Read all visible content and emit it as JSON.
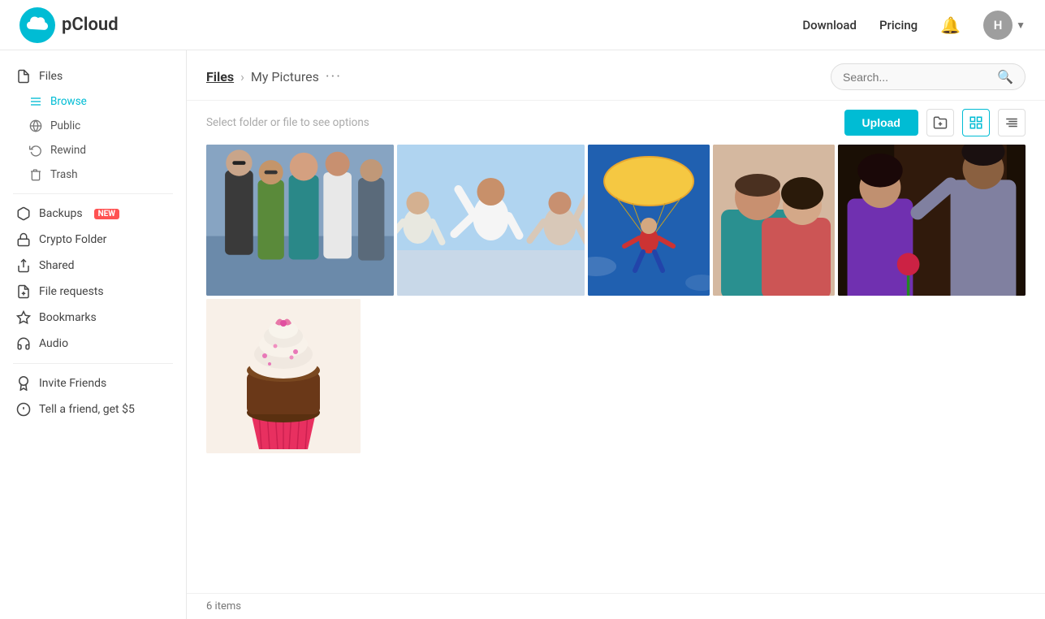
{
  "header": {
    "logo_text": "pCloud",
    "nav": {
      "download": "Download",
      "pricing": "Pricing"
    },
    "user_initial": "H"
  },
  "sidebar": {
    "files_label": "Files",
    "browse_label": "Browse",
    "public_label": "Public",
    "rewind_label": "Rewind",
    "trash_label": "Trash",
    "backups_label": "Backups",
    "backups_badge": "NEW",
    "crypto_folder_label": "Crypto Folder",
    "shared_label": "Shared",
    "file_requests_label": "File requests",
    "bookmarks_label": "Bookmarks",
    "audio_label": "Audio",
    "invite_friends_label": "Invite Friends",
    "tell_friend_label": "Tell a friend, get $5"
  },
  "toolbar": {
    "breadcrumb_root": "Files",
    "breadcrumb_current": "My Pictures",
    "breadcrumb_more": "···"
  },
  "search": {
    "placeholder": "Search..."
  },
  "actions": {
    "hint": "Select folder or file to see options",
    "upload_label": "Upload"
  },
  "photos": {
    "row1": [
      {
        "id": "photo1",
        "color": "#6b7a8d",
        "label": "Group of friends"
      },
      {
        "id": "photo2",
        "color": "#87a7c0",
        "label": "Celebration"
      },
      {
        "id": "photo3",
        "color": "#5b8fbd",
        "label": "Skydiving"
      },
      {
        "id": "photo4",
        "color": "#c9a98e",
        "label": "Couple"
      },
      {
        "id": "photo5",
        "color": "#4a3728",
        "label": "Couple at bar"
      }
    ],
    "row2": [
      {
        "id": "photo6",
        "color": "#e8b4a0",
        "label": "Cupcake"
      }
    ]
  },
  "footer": {
    "items_count": "6 items"
  }
}
